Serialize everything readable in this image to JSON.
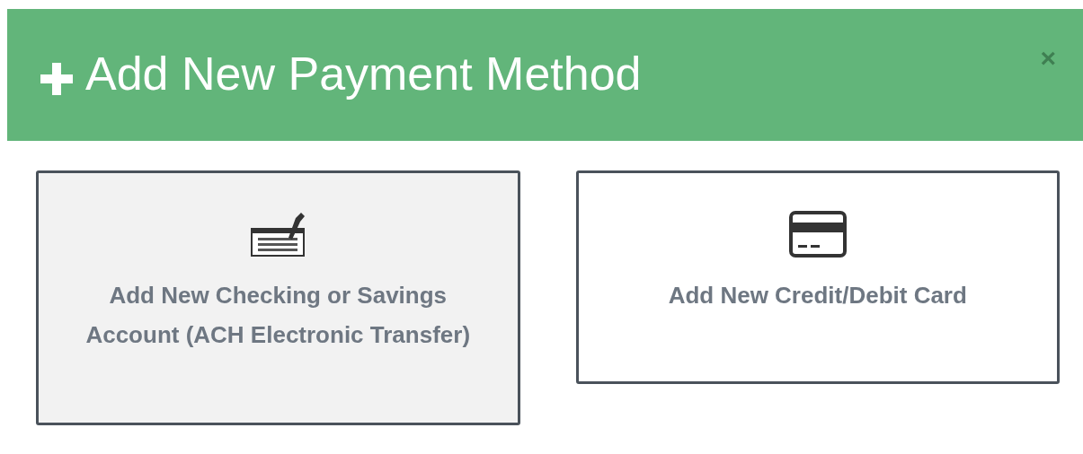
{
  "dialog": {
    "title": "Add New Payment Method",
    "close": "×"
  },
  "options": [
    {
      "kind": "check",
      "label": "Add New Checking or Savings Account (ACH Electronic Transfer)",
      "selected": true
    },
    {
      "kind": "card",
      "label": "Add New Credit/Debit Card",
      "selected": false
    }
  ]
}
